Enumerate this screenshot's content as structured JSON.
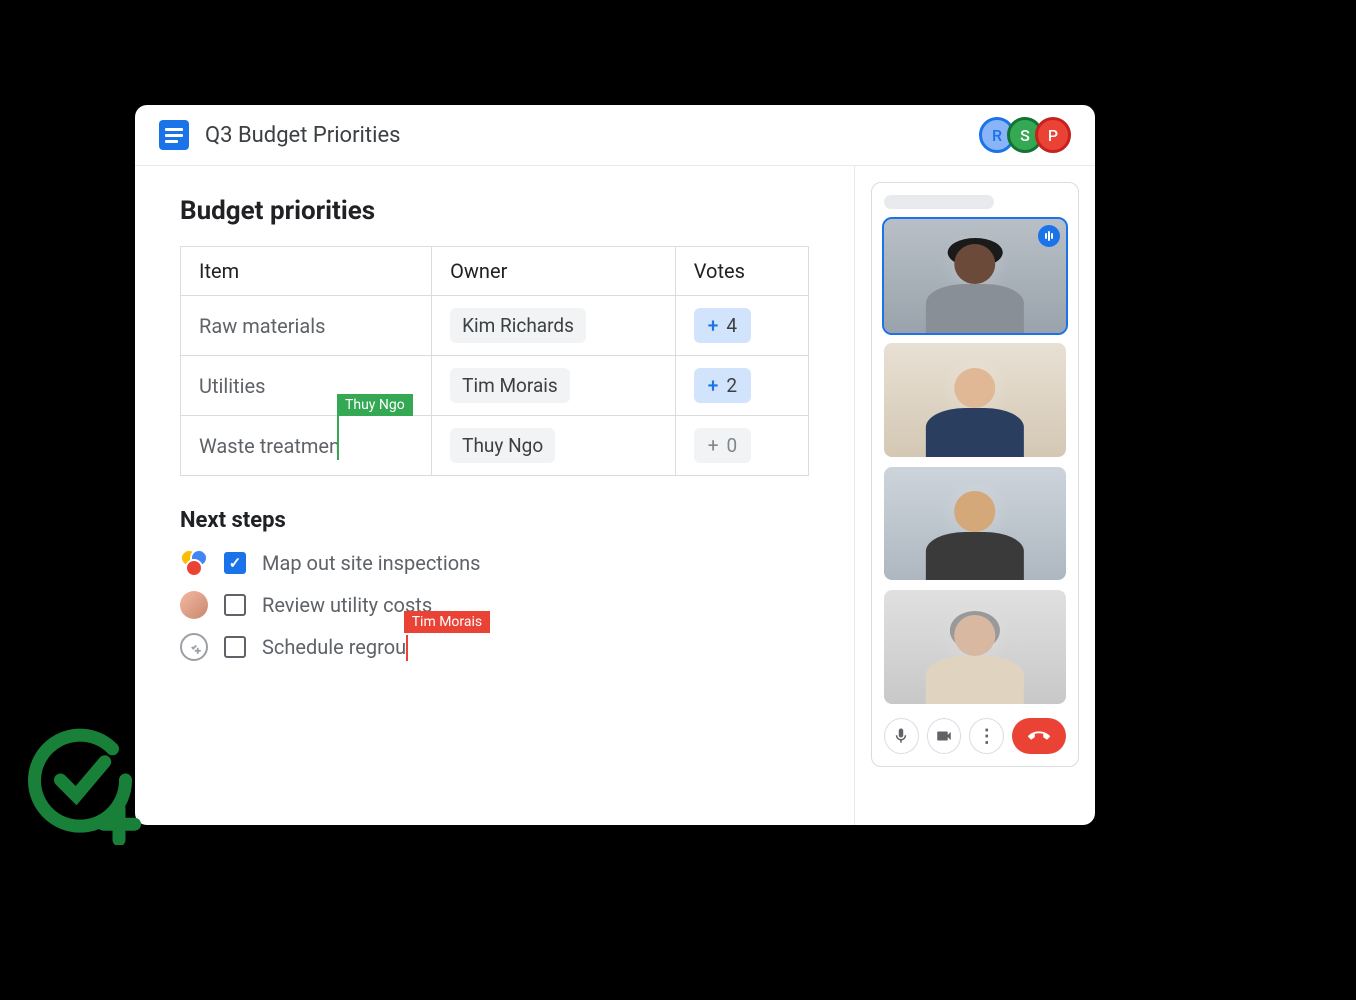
{
  "header": {
    "doc_title": "Q3 Budget Priorities",
    "collaborators": [
      {
        "initial": "R",
        "class": "av-r"
      },
      {
        "initial": "S",
        "class": "av-s"
      },
      {
        "initial": "P",
        "class": "av-p"
      }
    ]
  },
  "document": {
    "section_title": "Budget priorities",
    "table": {
      "headers": {
        "c1": "Item",
        "c2": "Owner",
        "c3": "Votes"
      },
      "rows": [
        {
          "item": "Raw materials",
          "owner": "Kim Richards",
          "votes": "4",
          "active": true
        },
        {
          "item": "Utilities",
          "owner": "Tim Morais",
          "votes": "2",
          "active": true
        },
        {
          "item": "Waste treatmen",
          "owner": "Thuy Ngo",
          "votes": "0",
          "active": false,
          "cursor_user": "Thuy Ngo"
        }
      ]
    },
    "next_steps_title": "Next steps",
    "steps": [
      {
        "text": "Map out site inspections",
        "checked": true
      },
      {
        "text": "Review utility costs",
        "checked": false
      },
      {
        "text": "Schedule regrou",
        "checked": false,
        "cursor_user": "Tim Morais"
      }
    ]
  },
  "meeting": {
    "controls": {
      "mic": "mic",
      "cam": "camera",
      "more": "more",
      "hangup": "hangup"
    }
  }
}
